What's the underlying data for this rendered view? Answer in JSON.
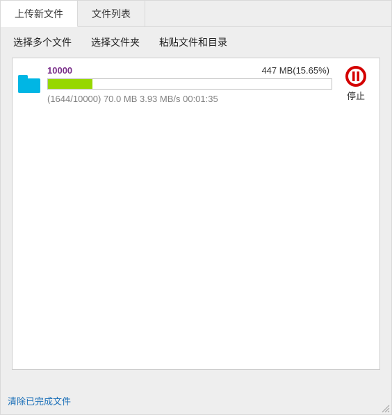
{
  "tabs": {
    "upload_new": "上传新文件",
    "file_list": "文件列表"
  },
  "toolbar": {
    "select_multiple": "选择多个文件",
    "select_folder": "选择文件夹",
    "paste_files": "粘贴文件和目录"
  },
  "upload": {
    "name": "10000",
    "size_text": "447 MB(15.65%)",
    "progress_percent": 15.65,
    "stats": "(1644/10000) 70.0 MB 3.93 MB/s 00:01:35"
  },
  "stop": {
    "label": "停止"
  },
  "footer": {
    "clear_finished": "清除已完成文件"
  },
  "colors": {
    "progress_fill": "#97d700",
    "folder_icon": "#00b6e4",
    "stop_ring": "#d40000",
    "link": "#1a6fb8"
  }
}
